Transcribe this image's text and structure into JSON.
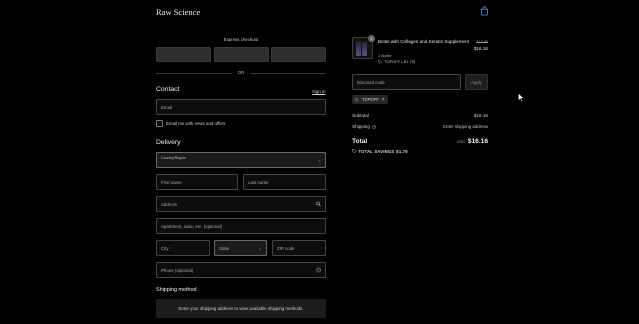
{
  "header": {
    "brand": "Raw Science",
    "cart_icon": "shopping-bag-icon"
  },
  "express": {
    "title": "Express checkout",
    "or_label": "OR"
  },
  "contact": {
    "heading": "Contact",
    "sign_in": "Sign in",
    "email_placeholder": "Email",
    "newsletter_label": "Email me with news and offers"
  },
  "delivery": {
    "heading": "Delivery",
    "country_label": "Country/Region",
    "country_value": "",
    "first_name": "First name",
    "last_name": "Last name",
    "address": "Address",
    "apartment": "Apartment, suite, etc. (optional)",
    "city": "City",
    "state": "State",
    "zip": "ZIP code",
    "phone": "Phone (optional)"
  },
  "shipping_method": {
    "heading": "Shipping method",
    "message": "Enter your shipping address to view available shipping methods."
  },
  "order": {
    "product": {
      "name": "Biotin with Collagen and Keratin Supplement",
      "variant": "1 Bottle",
      "discount_line": "TOPOFF (-$1.79)",
      "quantity": "1",
      "price_original": "$17.95",
      "price_current": "$16.16"
    },
    "discount": {
      "placeholder": "Discount code",
      "apply_label": "Apply",
      "applied_code": "TOPOFF"
    },
    "summary": {
      "subtotal_label": "Subtotal",
      "subtotal_value": "$16.16",
      "shipping_label": "Shipping",
      "shipping_value": "Enter shipping address",
      "total_label": "Total",
      "currency": "USD",
      "total_value": "$16.16",
      "savings_label": "TOTAL SAVINGS",
      "savings_value": "$1.79"
    }
  },
  "colors": {
    "background": "#000000",
    "field_border": "#444444",
    "button_fill": "#2f2f2f"
  }
}
